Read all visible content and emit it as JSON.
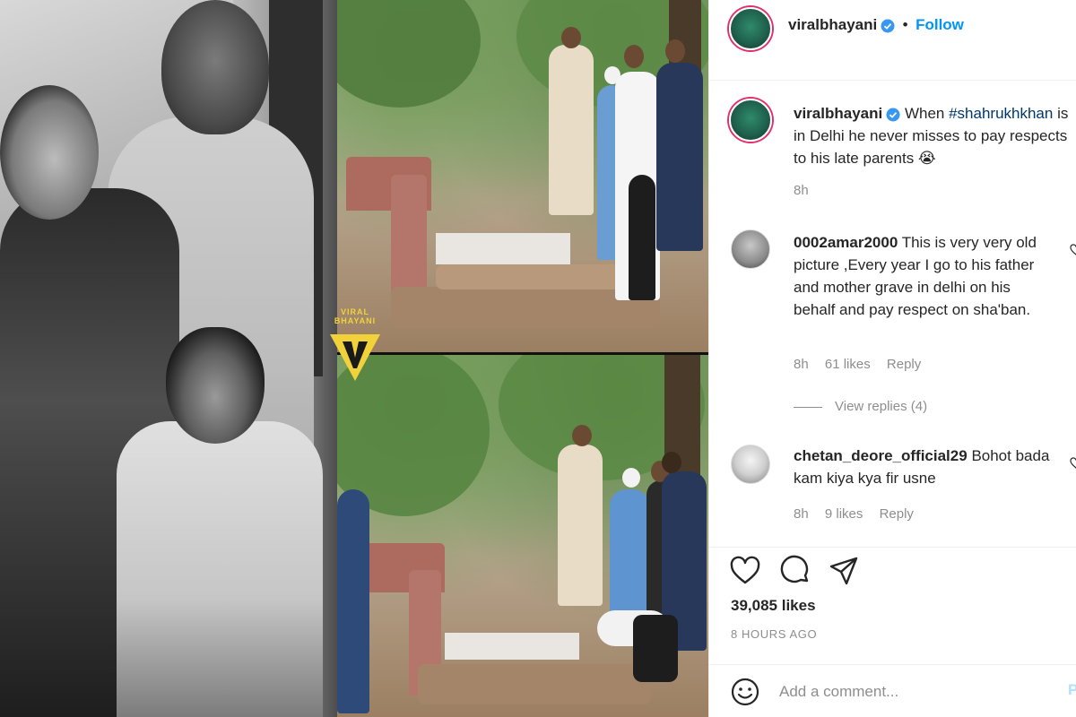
{
  "media": {
    "watermark_text": "VIRAL BHAYANI"
  },
  "header": {
    "username": "viralbhayani",
    "separator": "•",
    "follow_label": "Follow"
  },
  "caption": {
    "username": "viralbhayani",
    "text_before": "When ",
    "hashtag": "#shahrukhkhan",
    "text_after": " is in Delhi he never misses to pay respects to his late parents 😭",
    "time": "8h"
  },
  "comments": [
    {
      "username": "0002amar2000",
      "text": "This is very very old picture ,Every year I go to his father and mother grave in delhi on his behalf and pay respect on sha'ban.",
      "time": "8h",
      "likes": "61 likes",
      "reply_label": "Reply",
      "view_replies": "View replies (4)"
    },
    {
      "username": "chetan_deore_official29",
      "text": "Bohot bada kam kiya kya fir usne",
      "time": "8h",
      "likes": "9 likes",
      "reply_label": "Reply"
    }
  ],
  "actions": {
    "likes_count": "39,085 likes",
    "posted_ago": "8 HOURS AGO"
  },
  "add_comment": {
    "placeholder": "Add a comment...",
    "post_label": "P"
  },
  "colors": {
    "link_blue": "#0095f6",
    "hashtag": "#00376b",
    "muted": "#8e8e8e",
    "watermark_yellow": "#f2d23a"
  }
}
